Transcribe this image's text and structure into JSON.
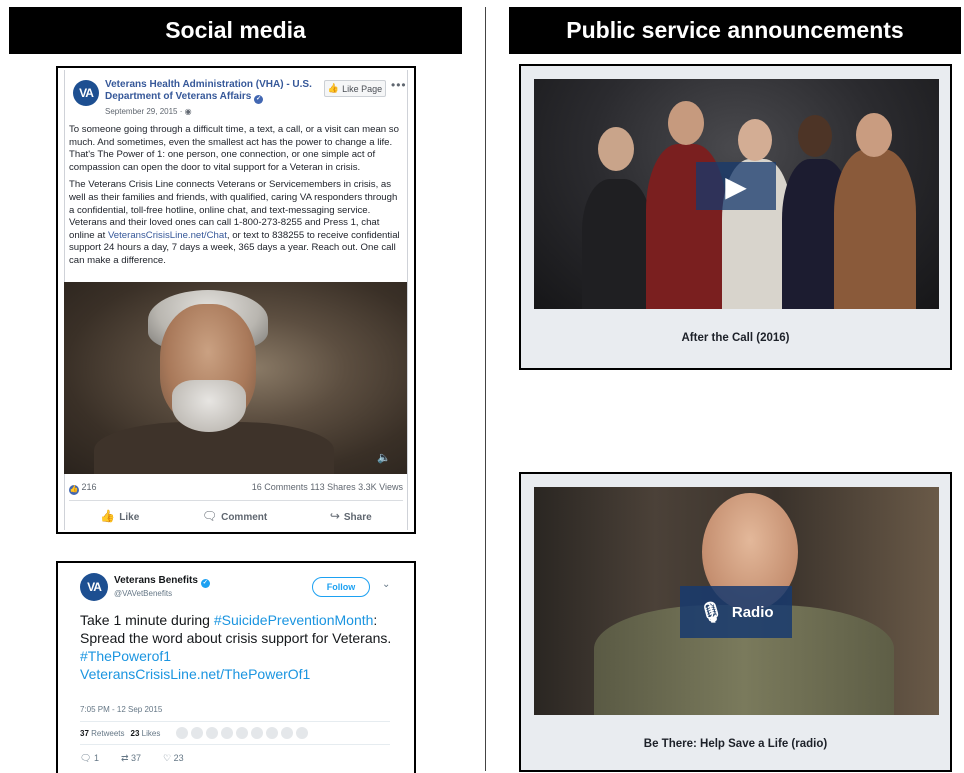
{
  "headers": {
    "left": "Social media",
    "right": "Public service announcements"
  },
  "facebook": {
    "avatar_text": "VA",
    "page_name": "Veterans Health Administration (VHA) - U.S. Department of Veterans Affairs",
    "date": "September 29, 2015 · ",
    "like_page_label": "Like Page",
    "more_label": "•••",
    "paragraph1": "To someone going through a difficult time, a text, a call, or a visit can mean so much. And sometimes, even the smallest act has the power to change a life. That's The Power of 1: one person, one connection, or one simple act of compassion can open the door to vital support for a Veteran in crisis.",
    "paragraph2_before": "The Veterans Crisis Line connects Veterans or Servicemembers in crisis, as well as their families and friends, with qualified, caring VA responders through a confidential, toll-free hotline, online chat, and text-messaging service. Veterans and their loved ones can call 1-800-273-8255 and Press 1, chat online at ",
    "paragraph2_link": "VeteransCrisisLine.net/Chat",
    "paragraph2_after": ", or text to 838255 to receive confidential support 24 hours a day, 7 days a week, 365 days a year. Reach out. One call can make a difference.",
    "likes_count": "216",
    "stats_right": "16 Comments  113 Shares  3.3K Views",
    "action_like": "Like",
    "action_comment": "Comment",
    "action_share": "Share"
  },
  "twitter": {
    "avatar_text": "VA",
    "name": "Veterans Benefits",
    "handle": "@VAVetBenefits",
    "follow_label": "Follow",
    "text_before": "Take 1 minute during ",
    "hashtag1": "#SuicidePreventionMonth",
    "text_middle": ": Spread the word about crisis support for Veterans.",
    "hashtag2": "#ThePowerof1",
    "link": "VeteransCrisisLine.net/ThePowerOf1",
    "timestamp": "7:05 PM - 12 Sep 2015",
    "retweets_count": "37",
    "retweets_label": "Retweets",
    "likes_count": "23",
    "likes_label": "Likes",
    "reply_count": "1",
    "retweet_count_bottom": "37",
    "like_count_bottom": "23"
  },
  "psa": {
    "video1_caption": "After the Call (2016)",
    "video2_caption": "Be There: Help Save a Life (radio)",
    "radio_label": "Radio"
  }
}
